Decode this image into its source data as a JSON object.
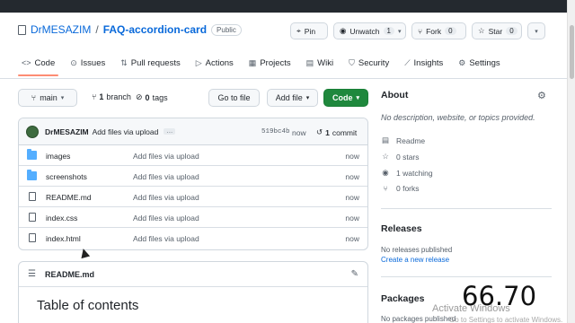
{
  "repo": {
    "owner": "DrMESAZIM",
    "separator": "/",
    "name": "FAQ-accordion-card",
    "visibility": "Public"
  },
  "header_actions": {
    "pin": "Pin",
    "unwatch": "Unwatch",
    "unwatch_count": "1",
    "fork": "Fork",
    "fork_count": "0",
    "star": "Star",
    "star_count": "0"
  },
  "tabs": [
    {
      "label": "Code",
      "icon": "code-icon"
    },
    {
      "label": "Issues",
      "icon": "issue-icon"
    },
    {
      "label": "Pull requests",
      "icon": "pull-request-icon"
    },
    {
      "label": "Actions",
      "icon": "play-icon"
    },
    {
      "label": "Projects",
      "icon": "table-icon"
    },
    {
      "label": "Wiki",
      "icon": "book-icon"
    },
    {
      "label": "Security",
      "icon": "shield-icon"
    },
    {
      "label": "Insights",
      "icon": "graph-icon"
    },
    {
      "label": "Settings",
      "icon": "gear-icon"
    }
  ],
  "branchbar": {
    "branch": "main",
    "branches_count": "1",
    "branches_label": "branch",
    "tags_count": "0",
    "tags_label": "tags",
    "go_to_file": "Go to file",
    "add_file": "Add file",
    "code": "Code"
  },
  "commit": {
    "author": "DrMESAZIM",
    "message": "Add files via upload",
    "ellipsis": "…",
    "sha": "519bc4b",
    "time": "now",
    "count": "1",
    "count_label": "commit"
  },
  "files": [
    {
      "name": "images",
      "type": "folder",
      "message": "Add files via upload",
      "time": "now"
    },
    {
      "name": "screenshots",
      "type": "folder",
      "message": "Add files via upload",
      "time": "now"
    },
    {
      "name": "README.md",
      "type": "file",
      "message": "Add files via upload",
      "time": "now"
    },
    {
      "name": "index.css",
      "type": "file",
      "message": "Add files via upload",
      "time": "now"
    },
    {
      "name": "index.html",
      "type": "file",
      "message": "Add files via upload",
      "time": "now"
    }
  ],
  "readme": {
    "filename": "README.md",
    "heading": "Table of contents"
  },
  "about": {
    "title": "About",
    "description": "No description, website, or topics provided.",
    "readme": "Readme",
    "stars": "0 stars",
    "watching": "1 watching",
    "forks": "0 forks"
  },
  "releases": {
    "title": "Releases",
    "none": "No releases published",
    "create": "Create a new release"
  },
  "packages": {
    "title": "Packages",
    "none": "No packages published"
  },
  "overlay": {
    "number": "66.70",
    "watermark": "Activate Windows",
    "watermark_sub": "Go to Settings to activate Windows."
  },
  "colors": {
    "link": "#0969da",
    "green_button": "#1f883d",
    "active_tab_underline": "#fd8c73",
    "folder": "#54aeff"
  }
}
